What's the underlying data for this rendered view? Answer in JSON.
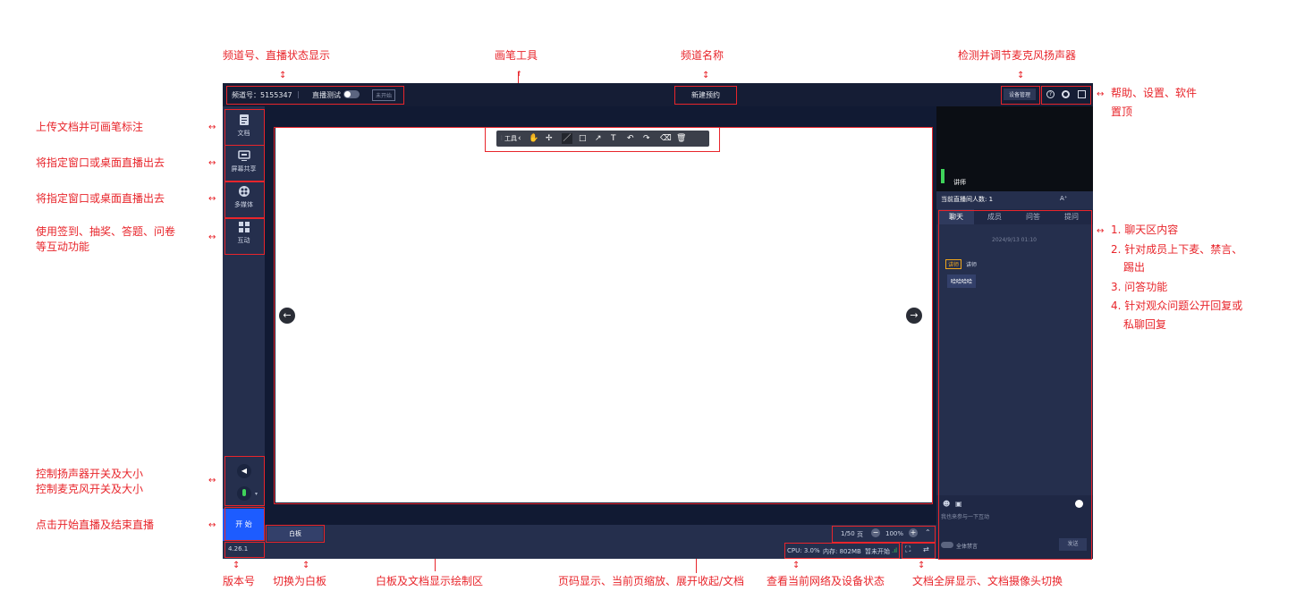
{
  "annotations": {
    "channel_status": "频道号、直播状态显示",
    "pen_tool": "画笔工具",
    "channel_name": "频道名称",
    "device_check": "检测并调节麦克风扬声器",
    "help_settings": "帮助、设置、软件",
    "help_settings_2": "置顶",
    "upload_doc": "上传文档并可画笔标注",
    "screen_share": "将指定窗口或桌面直播出去",
    "multimedia": "将指定窗口或桌面直播出去",
    "interaction": "使用签到、抽奖、答题、问卷",
    "interaction_2": "等互动功能",
    "chat_1": "1. 聊天区内容",
    "chat_2": "2. 针对成员上下麦、禁言、",
    "chat_2b": "踢出",
    "chat_3": "3. 问答功能",
    "chat_4": "4. 针对观众问题公开回复或",
    "chat_4b": "私聊回复",
    "speaker_ctrl": "控制扬声器开关及大小",
    "mic_ctrl": "控制麦克风开关及大小",
    "start_end": "点击开始直播及结束直播",
    "version_label": "版本号",
    "whiteboard_switch": "切换为白板",
    "drawing_area": "白板及文档显示绘制区",
    "page_controls": "页码显示、当前页缩放、展开收起/文档",
    "network_status": "查看当前网络及设备状态",
    "fullscreen": "文档全屏显示、文档摄像头切换"
  },
  "topbar": {
    "channel": "频道号：5155347",
    "separator": "|",
    "live_test": "直播测试",
    "status_badge": "未开始",
    "title": "新建预约",
    "device_mgmt": "设备管理"
  },
  "sidebar": {
    "items": [
      {
        "label": "文档",
        "icon": "document-icon"
      },
      {
        "label": "屏幕共享",
        "icon": "monitor-icon"
      },
      {
        "label": "多媒体",
        "icon": "media-icon"
      },
      {
        "label": "互动",
        "icon": "grid-icon"
      }
    ],
    "start_label": "开 始",
    "version": "4.26.1"
  },
  "toolbar": {
    "label": "工具",
    "collapse": "‹"
  },
  "bottom": {
    "whiteboard_tab": "白板",
    "page": "1/50",
    "page_unit": "页",
    "zoom": "100%",
    "cpu": "CPU: 3.0%",
    "memory": "内存: 802MB",
    "status": "暂未开始"
  },
  "right": {
    "teacher_label": "讲师",
    "online_count": "当前直播间人数: 1",
    "font_size": "A⁺",
    "tabs": [
      "聊天",
      "成员",
      "问答",
      "提问"
    ],
    "timestamp": "2024/9/13 01:10",
    "role_badge": "讲师",
    "sender": "讲师",
    "message": "哈哈哈哈",
    "input_placeholder": "我也来参与一下互动",
    "mute_all": "全体禁言",
    "send": "发送"
  },
  "colors": {
    "annotation": "#e8252b",
    "app_bg": "#1b2540",
    "panel": "#252f4d",
    "start_button": "#1d5cff"
  }
}
